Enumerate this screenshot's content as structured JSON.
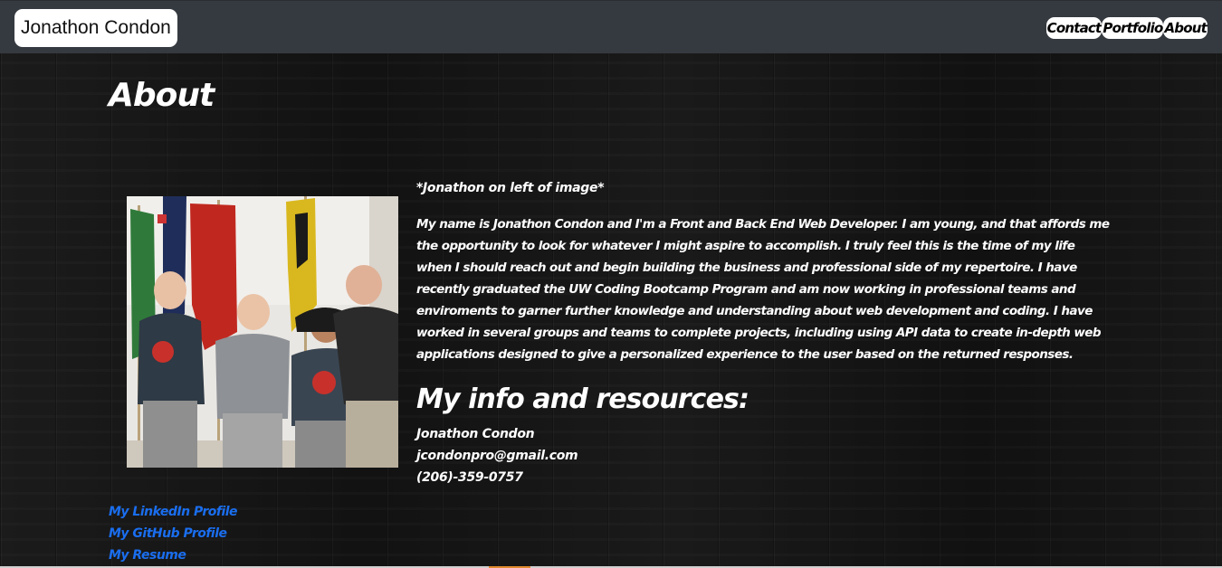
{
  "header": {
    "brand": "Jonathon Condon",
    "nav": [
      {
        "label": "Contact"
      },
      {
        "label": "Portfolio"
      },
      {
        "label": "About"
      }
    ]
  },
  "page": {
    "title": "About",
    "photo_caption": "*Jonathon on left of image*",
    "bio": "My name is Jonathon Condon and I'm a Front and Back End Web Developer. I am young, and that affords me the opportunity to look for whatever I might aspire to accomplish. I truly feel this is the time of my life when I should reach out and begin building the business and professional side of my repertoire. I have recently graduated the UW Coding Bootcamp Program and am now working in professional teams and enviroments to garner further knowledge and understanding about web development and coding. I have worked in several groups and teams to complete projects, including using API data to create in-depth web applications designed to give a personalized experience to the user based on the returned responses."
  },
  "info": {
    "heading": "My info and resources:",
    "name": "Jonathon Condon",
    "email": "jcondonpro@gmail.com",
    "phone": "(206)-359-0757"
  },
  "links": [
    {
      "label": "My LinkedIn Profile"
    },
    {
      "label": "My GitHub Profile"
    },
    {
      "label": "My Resume"
    }
  ],
  "colors": {
    "navbar": "#353a40",
    "link": "#1a6eef",
    "text": "#ffffff"
  }
}
